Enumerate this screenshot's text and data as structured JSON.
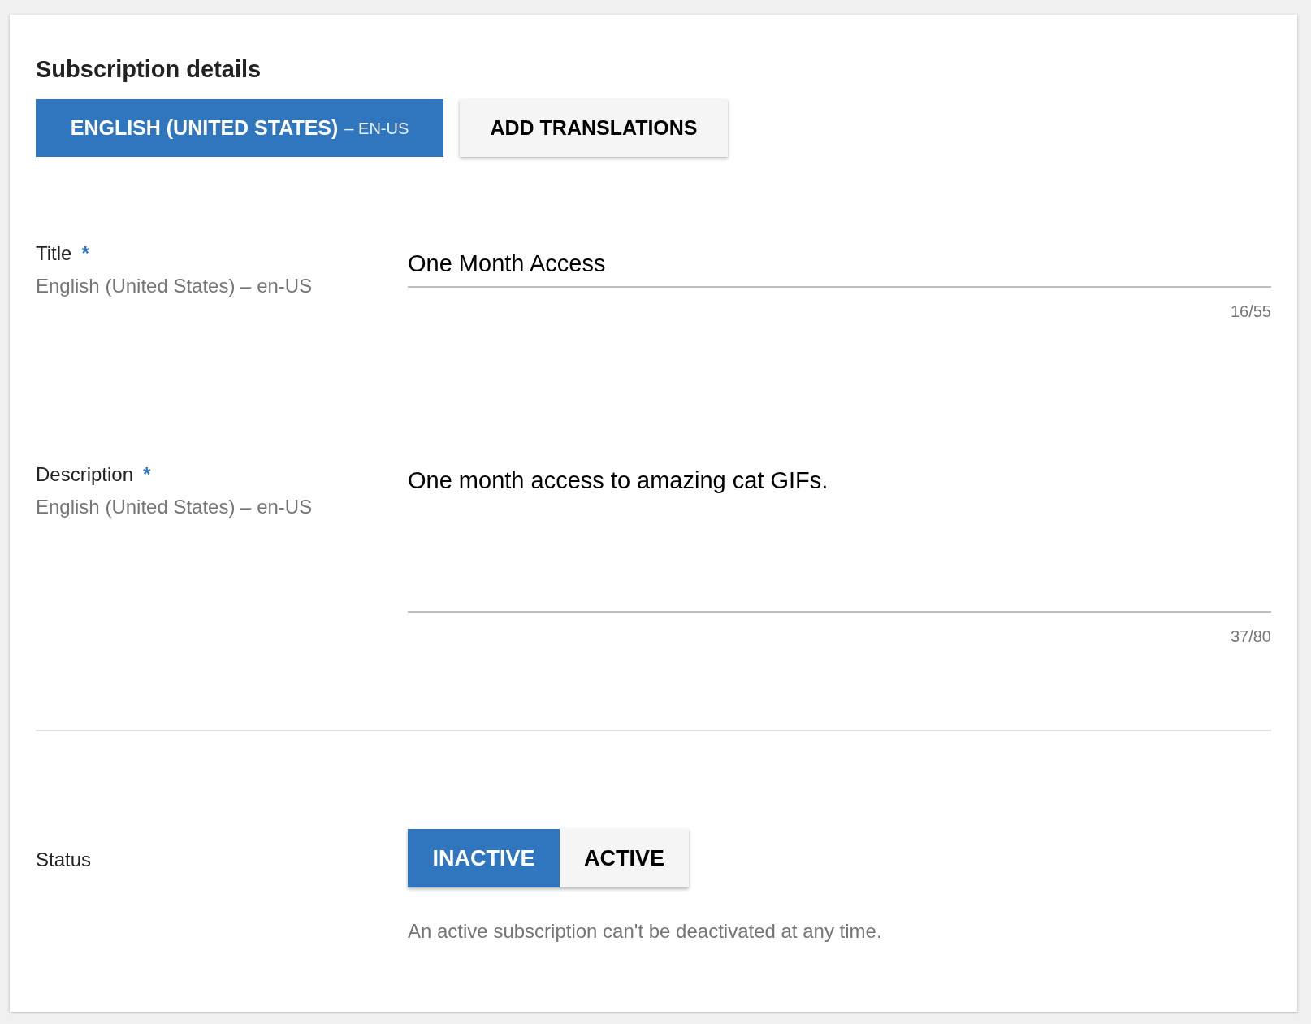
{
  "card": {
    "title": "Subscription details"
  },
  "language": {
    "label": "ENGLISH (UNITED STATES)",
    "code": "– EN-US",
    "selected": true
  },
  "add_translations": {
    "label": "ADD TRANSLATIONS"
  },
  "fields": [
    {
      "kind": "single",
      "label": "Title",
      "required_mark": "*",
      "sublabel": "English (United States) – en-US",
      "value": "One Month Access",
      "counter": "16/55"
    },
    {
      "kind": "multi",
      "label": "Description",
      "required_mark": "*",
      "sublabel": "English (United States) – en-US",
      "value": "One month access to amazing cat GIFs.",
      "counter": "37/80"
    }
  ],
  "status": {
    "label": "Status",
    "options": [
      {
        "label": "INACTIVE",
        "selected": true
      },
      {
        "label": "ACTIVE",
        "selected": false
      }
    ],
    "helper": "An active subscription can't be deactivated at any time."
  }
}
